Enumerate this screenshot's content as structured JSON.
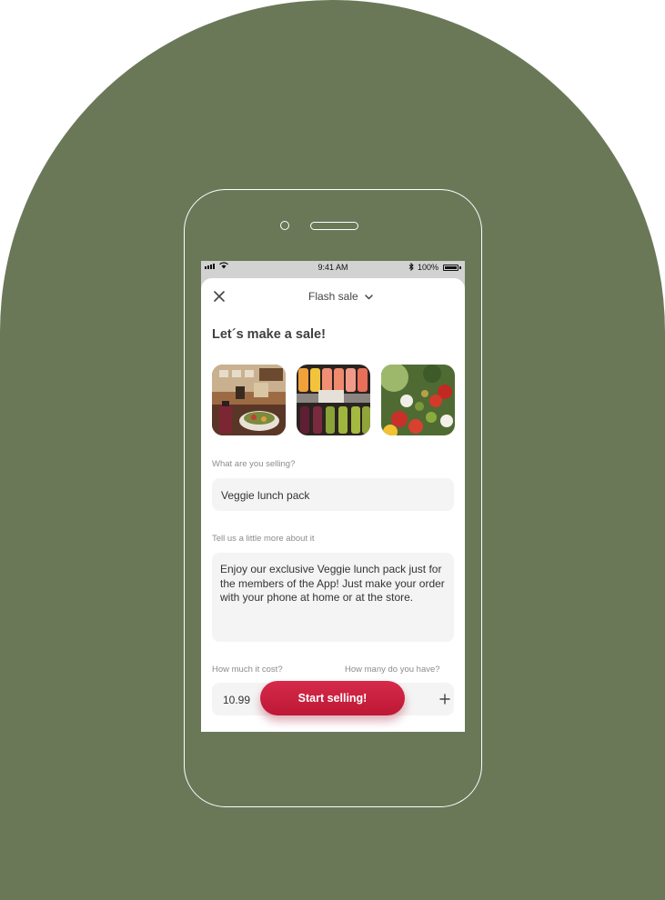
{
  "colors": {
    "background_shape": "#6a7858",
    "accent": "#c81e3f",
    "field_bg": "#f4f4f4"
  },
  "status_bar": {
    "time": "9:41 AM",
    "battery": "100%",
    "icons": [
      "signal-icon",
      "wifi-icon",
      "bluetooth-icon",
      "battery-icon"
    ]
  },
  "header": {
    "title": "Flash sale",
    "close_icon": "close-icon",
    "dropdown_icon": "chevron-down-icon"
  },
  "heading": "Let´s make a sale!",
  "photos": [
    "cafe-counter-photo",
    "juice-bottles-photo",
    "salad-photo"
  ],
  "selling": {
    "label": "What are you selling?",
    "value": "Veggie lunch pack"
  },
  "description": {
    "label": "Tell us a little more about it",
    "value": "Enjoy our exclusive Veggie lunch pack just for the members of the App! Just make your order with your phone at home or at the store."
  },
  "price": {
    "label": "How much it cost?",
    "value": "10.99"
  },
  "quantity": {
    "label": "How many do you have?",
    "increment_icon": "plus-icon"
  },
  "cta": {
    "label": "Start selling!"
  }
}
